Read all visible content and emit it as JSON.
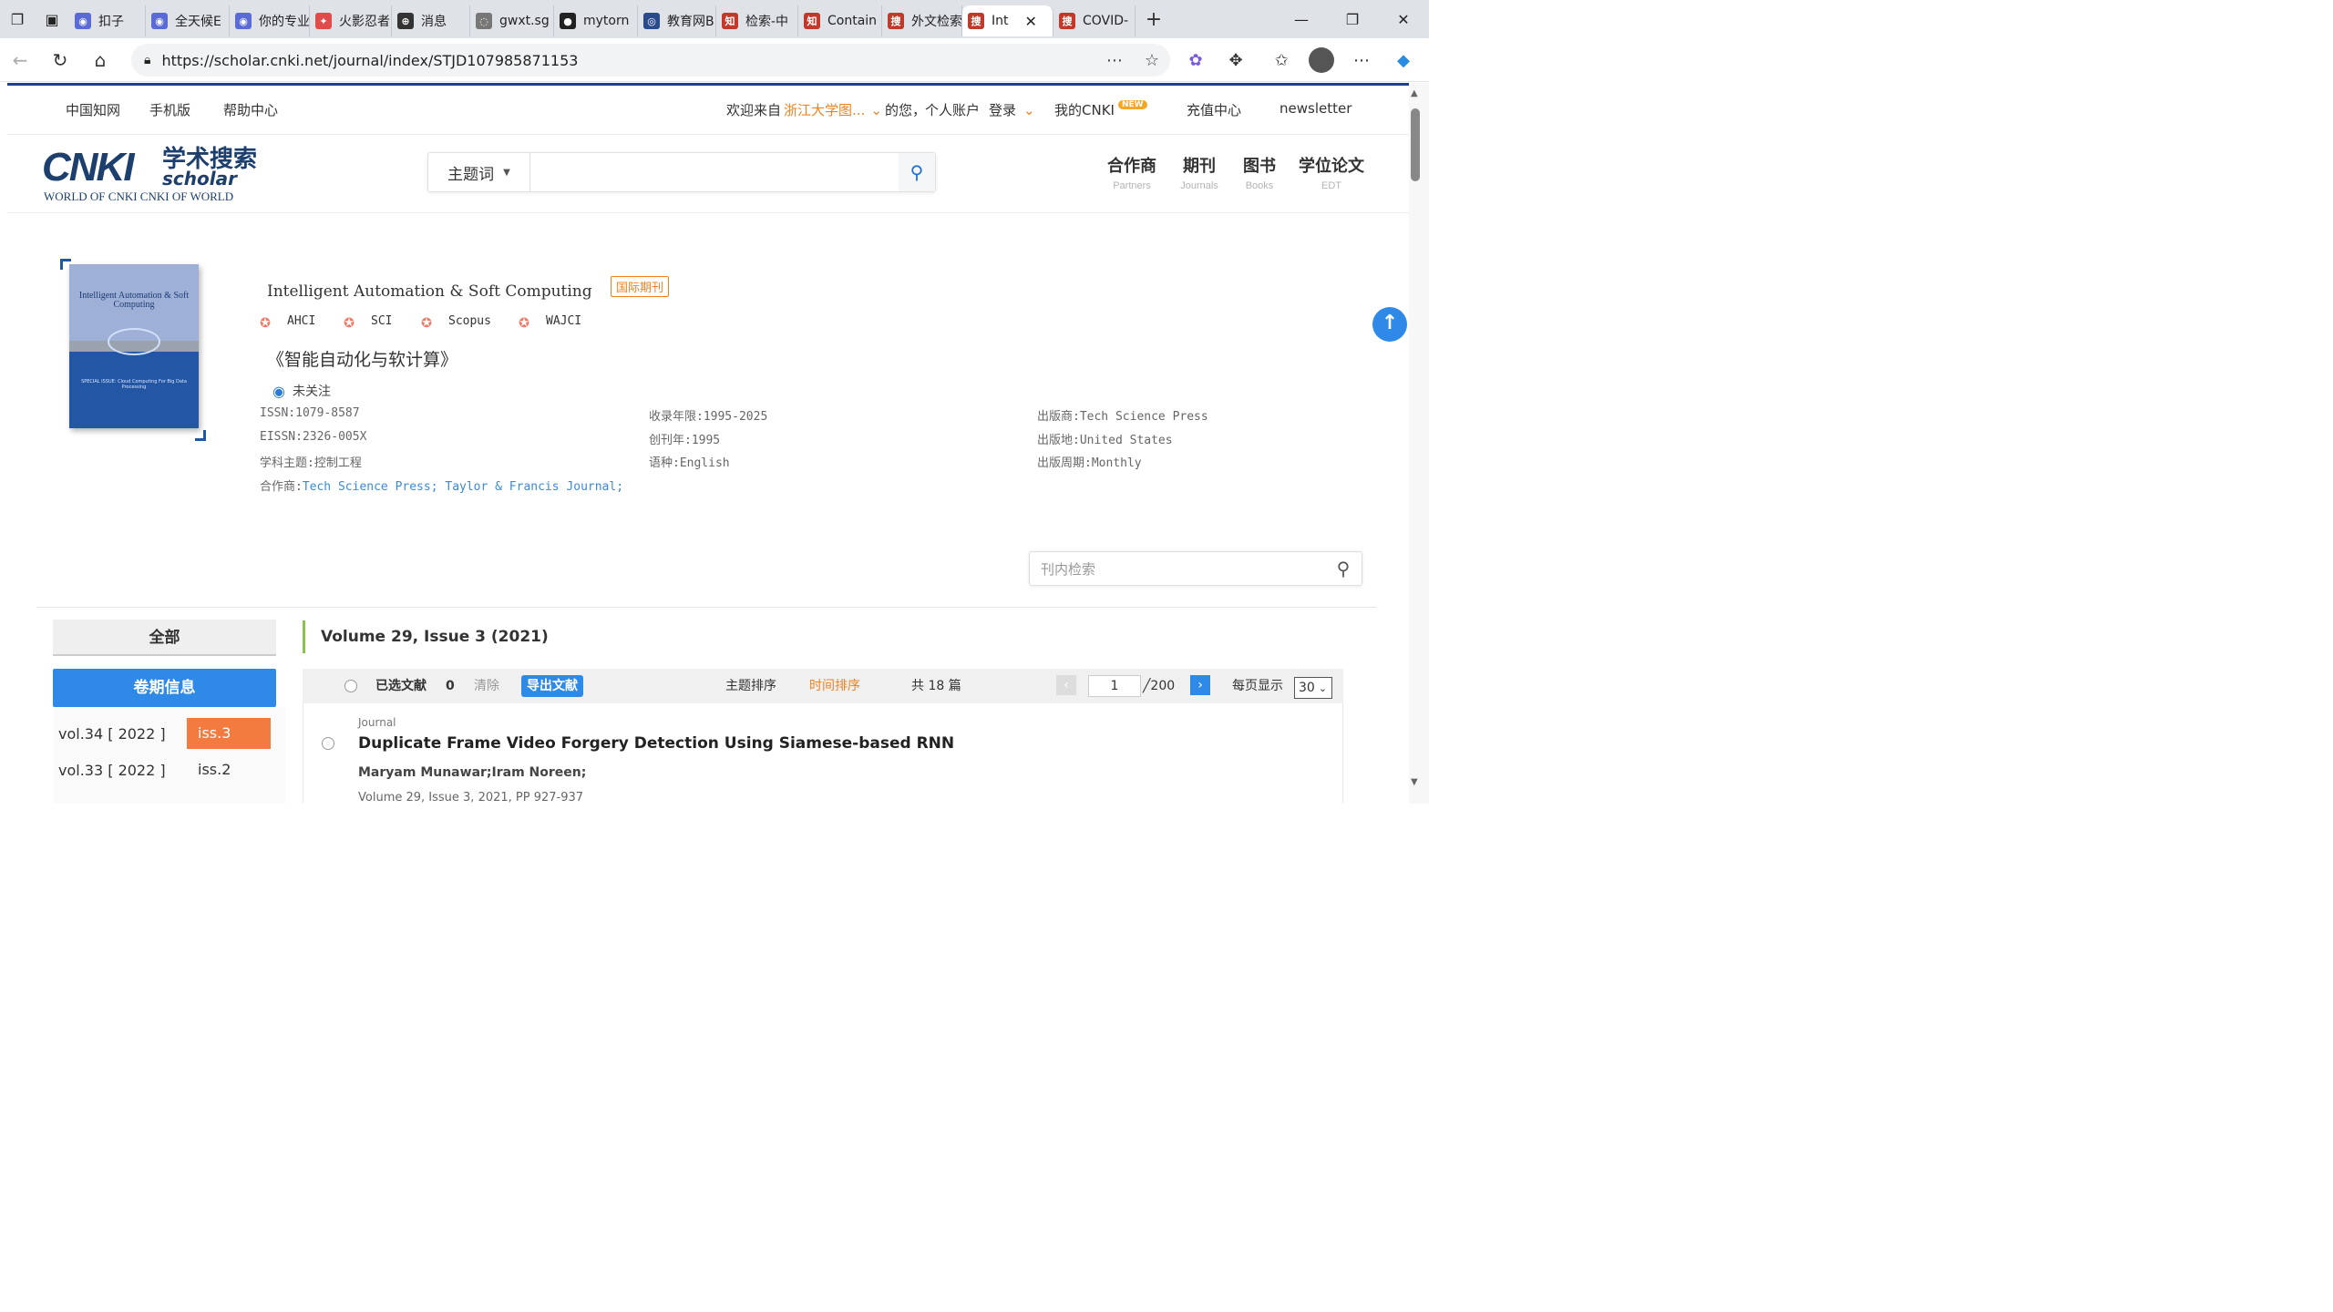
{
  "browser": {
    "tabs": [
      {
        "label": "扣子",
        "color": "#5b6bd6",
        "glyph": "◉"
      },
      {
        "label": "全天候E",
        "color": "#5b6bd6",
        "glyph": "◉"
      },
      {
        "label": "你的专业",
        "color": "#5b6bd6",
        "glyph": "◉"
      },
      {
        "label": "火影忍者",
        "color": "#e04b4b",
        "glyph": "✦"
      },
      {
        "label": "消息",
        "color": "#333333",
        "glyph": "⊕"
      },
      {
        "label": "gwxt.sg",
        "color": "#777777",
        "glyph": "◌"
      },
      {
        "label": "mytorn",
        "color": "#222222",
        "glyph": "●"
      },
      {
        "label": "教育网B",
        "color": "#2a4a8a",
        "glyph": "◎"
      },
      {
        "label": "检索-中",
        "color": "#c0392b",
        "glyph": "知"
      },
      {
        "label": "Contain",
        "color": "#c0392b",
        "glyph": "知"
      },
      {
        "label": "外文检索",
        "color": "#c0392b",
        "glyph": "搜"
      },
      {
        "label": "Int",
        "color": "#c0392b",
        "glyph": "搜",
        "active": true
      },
      {
        "label": "COVID-",
        "color": "#c0392b",
        "glyph": "搜"
      }
    ],
    "url": "https://scholar.cnki.net/journal/index/STJD107985871153"
  },
  "topnav": {
    "cnki": "中国知网",
    "mobile": "手机版",
    "help": "帮助中心",
    "welcome_prefix": "欢迎来自",
    "institution": "浙江大学图...",
    "welcome_suffix": "的您，",
    "personal": "个人账户",
    "login": "登录",
    "mycnki": "我的CNKI",
    "new_badge": "NEW",
    "recharge": "充值中心",
    "newsletter": "newsletter"
  },
  "logo": {
    "main": "CNKI",
    "cn": "学术搜索",
    "scholar": "scholar",
    "sub": "WORLD OF CNKI CNKI OF WORLD"
  },
  "search": {
    "field": "主题词",
    "value": ""
  },
  "header_nav": [
    {
      "zh": "合作商",
      "en": "Partners"
    },
    {
      "zh": "期刊",
      "en": "Journals"
    },
    {
      "zh": "图书",
      "en": "Books"
    },
    {
      "zh": "学位论文",
      "en": "EDT"
    }
  ],
  "journal": {
    "cover_title": "Intelligent Automation & Soft Computing",
    "cover_sub": "AN INTERNATIONAL JOURNAL",
    "cover_special": "SPECIAL ISSUE: Cloud Computing For Big Data Processing",
    "title": "Intelligent Automation & Soft Computing",
    "badge": "国际期刊",
    "indexes": [
      "AHCI",
      "SCI",
      "Scopus",
      "WAJCI"
    ],
    "title_cn": "《智能自动化与软计算》",
    "follow": "未关注",
    "issn": "ISSN:1079-8587",
    "eissn": "EISSN:2326-005X",
    "subject": "学科主题:控制工程",
    "partners_label": "合作商:",
    "partners": "Tech Science Press; Taylor & Francis Journal;",
    "years": "收录年限:1995-2025",
    "founded": "创刊年:1995",
    "language": "语种:English",
    "publisher": "出版商:Tech Science Press",
    "place": "出版地:United States",
    "frequency": "出版周期:Monthly"
  },
  "inner_search": {
    "placeholder": "刊内检索"
  },
  "sidebar": {
    "all": "全部",
    "volumes_btn": "卷期信息",
    "volumes": [
      {
        "vol": "vol.34 [ 2022 ]",
        "iss": "iss.3",
        "active": true
      },
      {
        "vol": "vol.33 [ 2022 ]",
        "iss": "iss.2",
        "active": false
      }
    ]
  },
  "issue": {
    "title": "Volume 29, Issue 3 (2021)",
    "selected_label": "已选文献",
    "selected_count": "0",
    "clear": "清除",
    "export": "导出文献",
    "sort_topic": "主题排序",
    "sort_time": "时间排序",
    "total": "共 18 篇",
    "page": "1",
    "pages": "╱200",
    "per_page_label": "每页显示",
    "per_page": "30"
  },
  "results": [
    {
      "type": "Journal",
      "title": "Duplicate Frame Video Forgery Detection Using Siamese-based RNN",
      "authors": "Maryam Munawar;Iram Noreen;",
      "source": "Volume 29, Issue 3, 2021, PP 927-937"
    }
  ]
}
